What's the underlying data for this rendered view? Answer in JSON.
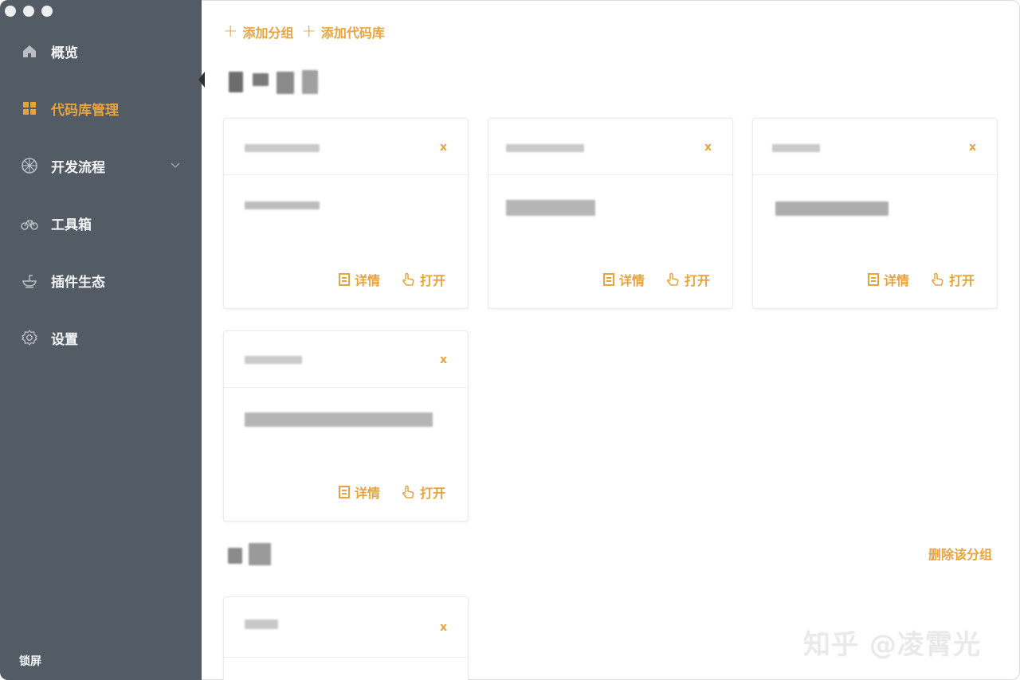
{
  "sidebar": {
    "items": [
      {
        "label": "概览",
        "icon": "home-icon"
      },
      {
        "label": "代码库管理",
        "icon": "grid-icon"
      },
      {
        "label": "开发流程",
        "icon": "wheel-icon"
      },
      {
        "label": "工具箱",
        "icon": "bicycle-icon"
      },
      {
        "label": "插件生态",
        "icon": "plugin-bowl-icon"
      },
      {
        "label": "设置",
        "icon": "gear-icon"
      }
    ],
    "active_index": 1,
    "lock_label": "锁屏"
  },
  "toolbar": {
    "add_group": "添加分组",
    "add_repo": "添加代码库"
  },
  "card_actions": {
    "close_label": "x",
    "detail_label": "详情",
    "open_label": "打开"
  },
  "groups": [
    {
      "delete_label": ""
    },
    {
      "delete_label": "删除该分组"
    }
  ],
  "watermark": "知乎 @凌霄光",
  "colors": {
    "accent": "#e8a33d",
    "sidebar_bg": "#535b65",
    "sidebar_text": "#f2f4f6"
  }
}
